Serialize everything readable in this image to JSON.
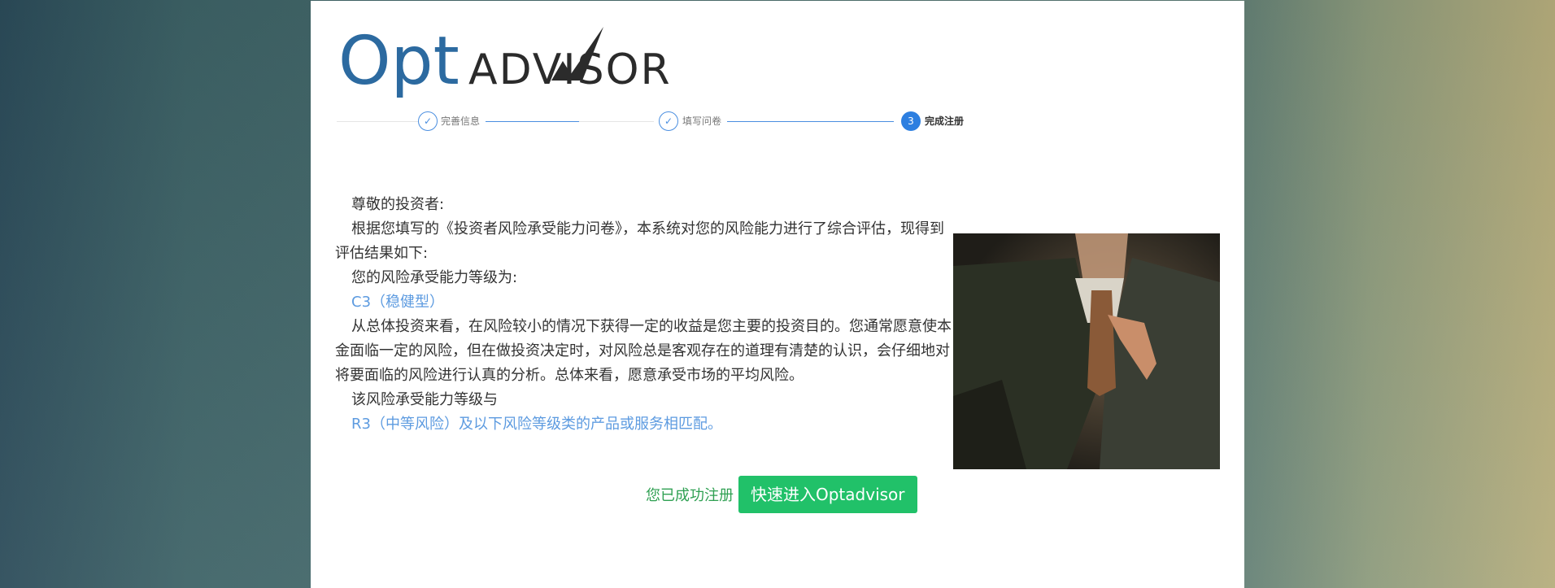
{
  "logo": {
    "text_opt": "Opt",
    "text_advisor": "ADVISOR",
    "color_opt": "#2c6aa0",
    "color_advisor": "#2b2b2b"
  },
  "stepper": {
    "steps": [
      {
        "label": "完善信息",
        "status": "done",
        "icon": "check-icon"
      },
      {
        "label": "填写问卷",
        "status": "done",
        "icon": "check-icon"
      },
      {
        "label": "完成注册",
        "status": "current",
        "number": "3"
      }
    ],
    "accent_color": "#2d7fe0"
  },
  "result": {
    "greeting": "尊敬的投资者:",
    "intro": "根据您填写的《投资者风险承受能力问卷》，本系统对您的风险能力进行了综合评估，现得到评估结果如下:",
    "level_prefix": "您的风险承受能力等级为:",
    "level_value": "C3（稳健型）",
    "description": "从总体投资来看，在风险较小的情况下获得一定的收益是您主要的投资目的。您通常愿意使本金面临一定的风险，但在做投资决定时，对风险总是客观存在的道理有清楚的认识，会仔细地对将要面临的风险进行认真的分析。总体来看，愿意承受市场的平均风险。",
    "match_prefix": "该风险承受能力等级与",
    "match_value": "R3（中等风险）及以下风险等级类的产品或服务相匹配。"
  },
  "photo": {
    "icon": "businessman-photo"
  },
  "footer": {
    "success_text": "您已成功注册",
    "enter_button": "快速进入Optadvisor",
    "button_color": "#21c169"
  }
}
